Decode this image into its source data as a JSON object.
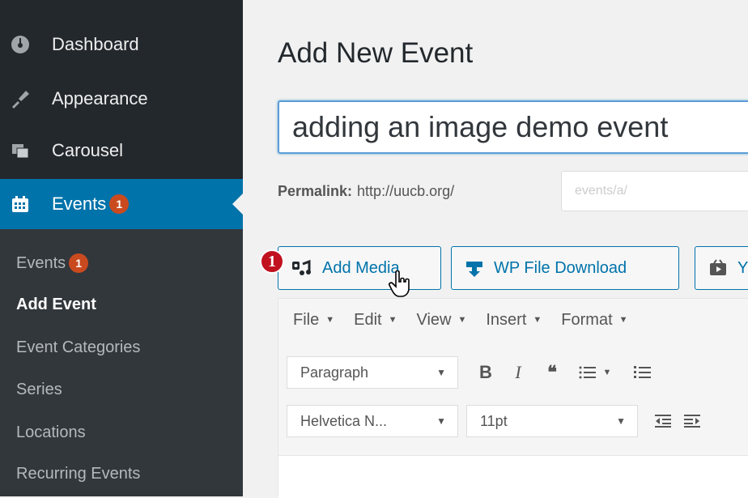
{
  "sidebar": {
    "items": [
      {
        "label": "Dashboard",
        "icon": "dashboard-icon"
      },
      {
        "label": "Appearance",
        "icon": "paintbrush-icon"
      },
      {
        "label": "Carousel",
        "icon": "carousel-icon"
      },
      {
        "label": "Events",
        "icon": "calendar-icon",
        "badge": "1",
        "active": true
      }
    ],
    "submenu": [
      {
        "label": "Events",
        "badge": "1"
      },
      {
        "label": "Add Event",
        "current": true
      },
      {
        "label": "Event Categories"
      },
      {
        "label": "Series"
      },
      {
        "label": "Locations"
      },
      {
        "label": "Recurring Events"
      }
    ]
  },
  "page": {
    "title": "Add New Event",
    "post_title_value": "adding an image demo event",
    "permalink_label": "Permalink:",
    "permalink_base": "http://uucb.org/",
    "slug_placeholder": "events/a/"
  },
  "media_buttons": {
    "step_number": "1",
    "add_media": "Add Media",
    "wp_file_download": "WP File Download",
    "third_partial": "Y"
  },
  "editor": {
    "menu": [
      "File",
      "Edit",
      "View",
      "Insert",
      "Format"
    ],
    "format_select": "Paragraph",
    "font_select": "Helvetica N...",
    "size_select": "11pt"
  },
  "colors": {
    "sidebar_bg": "#23282d",
    "submenu_bg": "#32373c",
    "accent": "#0073aa",
    "badge": "#ca4a1f",
    "step_marker": "#c1121f"
  }
}
